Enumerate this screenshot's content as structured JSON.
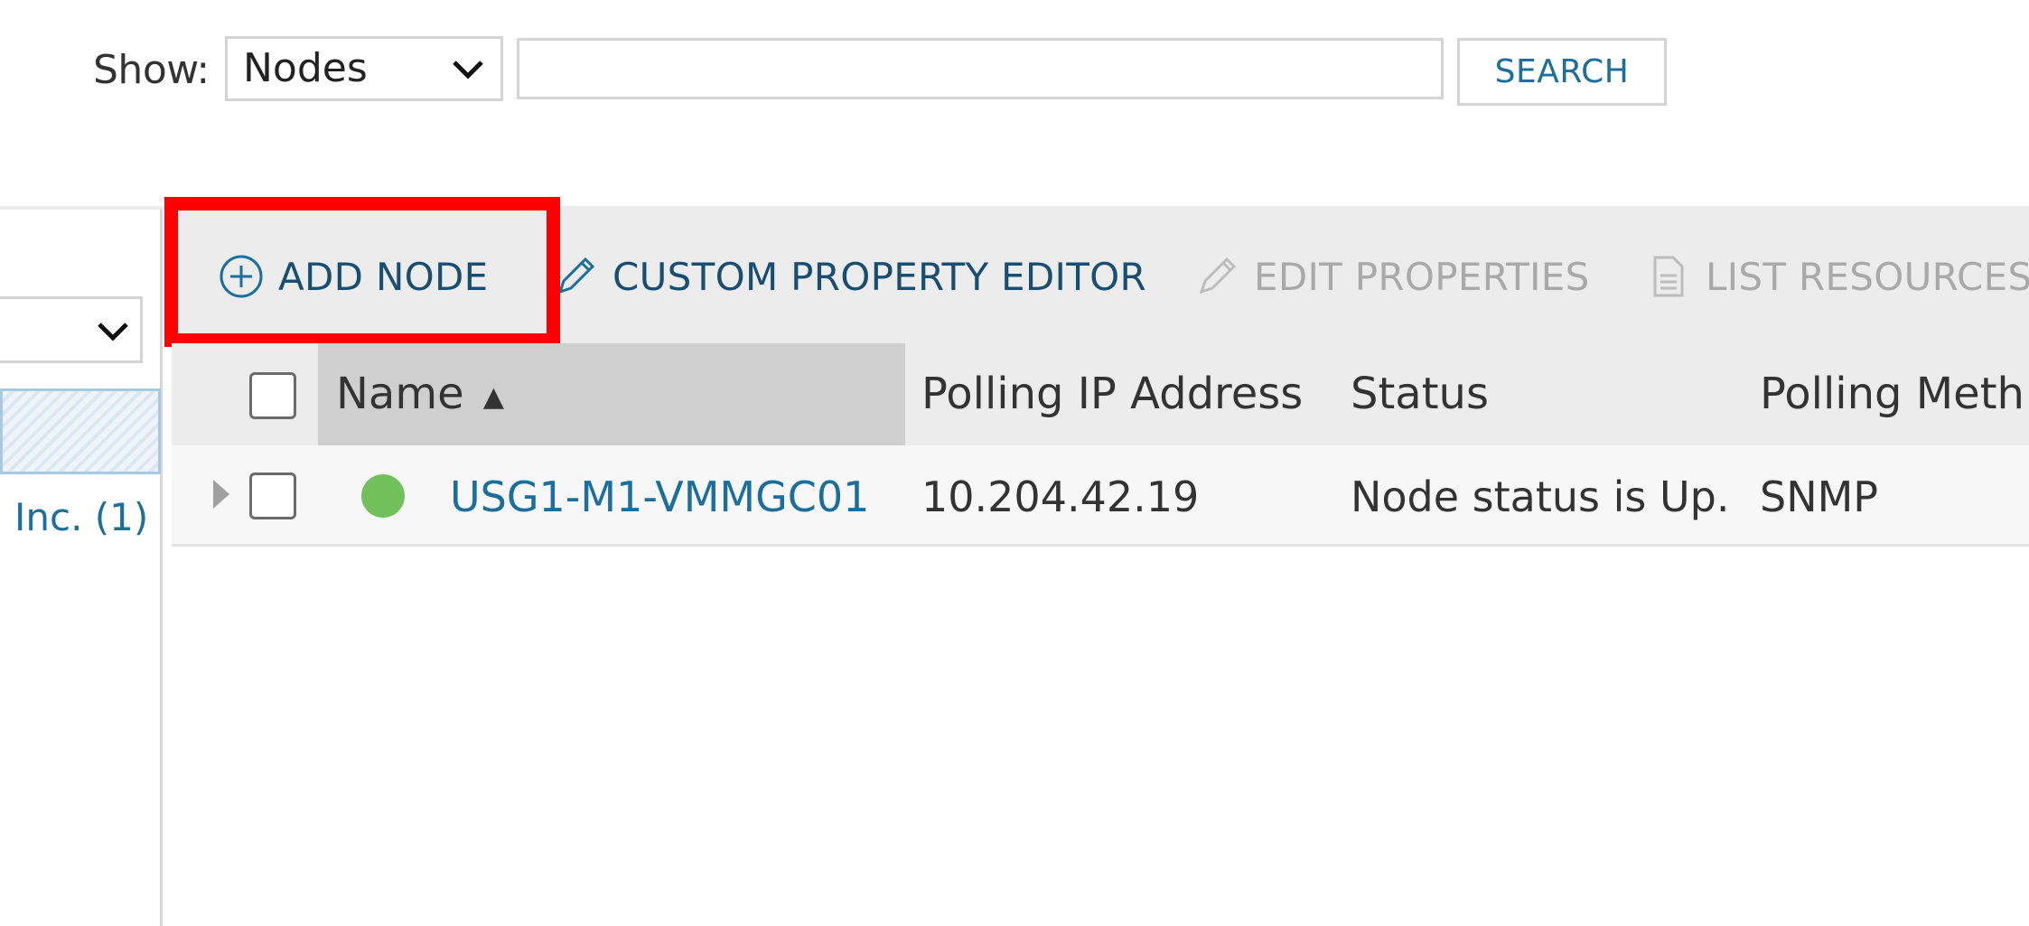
{
  "search_bar": {
    "show_label": "Show:",
    "show_value": "Nodes",
    "search_value": "",
    "search_button": "SEARCH"
  },
  "left_panel": {
    "group_link": "Inc. (1)"
  },
  "toolbar": {
    "add_node": "ADD NODE",
    "custom_property_editor": "CUSTOM PROPERTY EDITOR",
    "edit_properties": "EDIT PROPERTIES",
    "list_resources": "LIST RESOURCES"
  },
  "table": {
    "columns": [
      "Name",
      "Polling IP Address",
      "Status",
      "Polling Meth"
    ],
    "sort_indicator": "▲",
    "rows": [
      {
        "name": "USG1-M1-VMMGC01",
        "ip": "10.204.42.19",
        "status": "Node status is Up.",
        "polling_method": "SNMP",
        "status_color": "#72c05b"
      }
    ]
  },
  "colors": {
    "link": "#1c6e9b",
    "highlight": "#ff0000",
    "disabled": "#a9a9a9"
  }
}
